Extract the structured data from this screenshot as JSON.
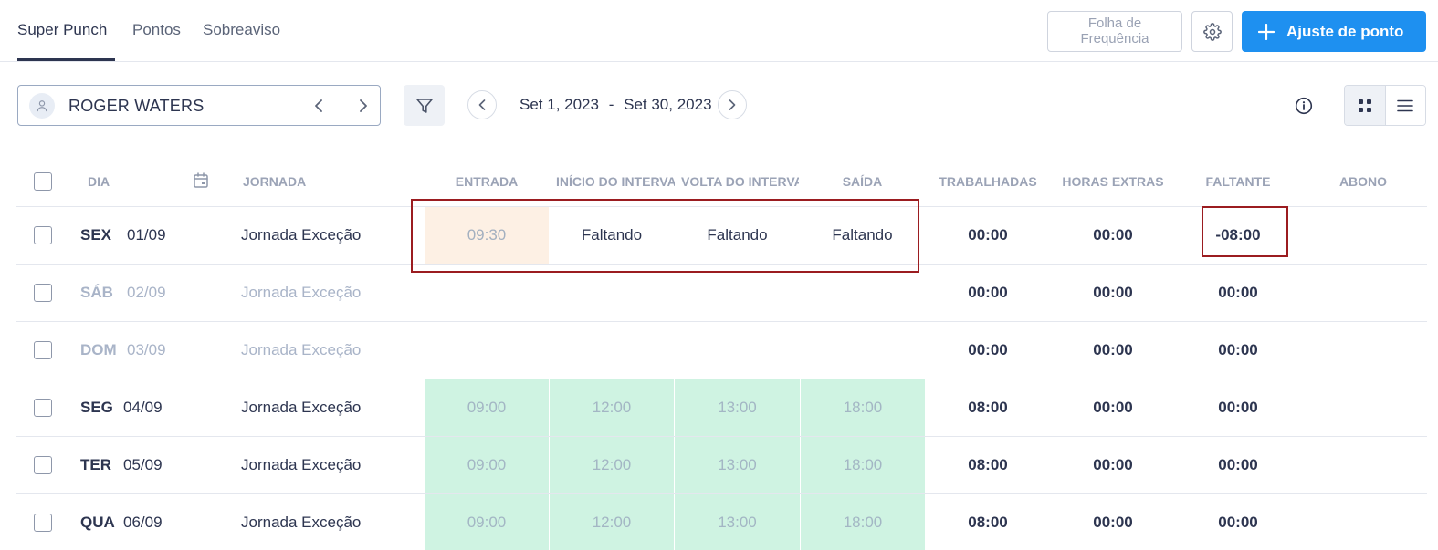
{
  "tabs": [
    {
      "label": "Super Punch",
      "active": true
    },
    {
      "label": "Pontos",
      "active": false
    },
    {
      "label": "Sobreaviso",
      "active": false
    }
  ],
  "header_actions": {
    "folha_line1": "Folha de",
    "folha_line2": "Frequência",
    "settings_icon": "gear-icon",
    "ajuste_label": "Ajuste de ponto",
    "ajuste_color": "#1e90f0"
  },
  "toolbar": {
    "employee_name": "ROGER WATERS",
    "date_start": "Set 1, 2023",
    "date_separator": "-",
    "date_end": "Set 30, 2023"
  },
  "table": {
    "columns": {
      "dia": "DIA",
      "jornada": "JORNADA",
      "entrada": "ENTRADA",
      "inicio": "INÍCIO DO INTERVALO",
      "volta": "VOLTA DO INTERVALO",
      "saida": "SAÍDA",
      "trabalhadas": "TRABALHADAS",
      "horas_extras": "HORAS EXTRAS",
      "faltante": "FALTANTE",
      "abono": "ABONO"
    },
    "rows": [
      {
        "weekday": "SEX",
        "date": "01/09",
        "jornada": "Jornada Exceção",
        "entrada": "09:30",
        "inicio": "Faltando",
        "volta": "Faltando",
        "saida": "Faltando",
        "trabalhadas": "00:00",
        "horas_extras": "00:00",
        "faltante": "-08:00",
        "abono": ""
      },
      {
        "weekday": "SÁB",
        "date": "02/09",
        "jornada": "Jornada Exceção",
        "entrada": "",
        "inicio": "",
        "volta": "",
        "saida": "",
        "trabalhadas": "00:00",
        "horas_extras": "00:00",
        "faltante": "00:00",
        "abono": ""
      },
      {
        "weekday": "DOM",
        "date": "03/09",
        "jornada": "Jornada Exceção",
        "entrada": "",
        "inicio": "",
        "volta": "",
        "saida": "",
        "trabalhadas": "00:00",
        "horas_extras": "00:00",
        "faltante": "00:00",
        "abono": ""
      },
      {
        "weekday": "SEG",
        "date": "04/09",
        "jornada": "Jornada Exceção",
        "entrada": "09:00",
        "inicio": "12:00",
        "volta": "13:00",
        "saida": "18:00",
        "trabalhadas": "08:00",
        "horas_extras": "00:00",
        "faltante": "00:00",
        "abono": ""
      },
      {
        "weekday": "TER",
        "date": "05/09",
        "jornada": "Jornada Exceção",
        "entrada": "09:00",
        "inicio": "12:00",
        "volta": "13:00",
        "saida": "18:00",
        "trabalhadas": "08:00",
        "horas_extras": "00:00",
        "faltante": "00:00",
        "abono": ""
      },
      {
        "weekday": "QUA",
        "date": "06/09",
        "jornada": "Jornada Exceção",
        "entrada": "09:00",
        "inicio": "12:00",
        "volta": "13:00",
        "saida": "18:00",
        "trabalhadas": "08:00",
        "horas_extras": "00:00",
        "faltante": "00:00",
        "abono": ""
      }
    ]
  },
  "colors": {
    "punch_ok_bg": "#cff3e2",
    "punch_partial_bg": "#fdf0e4",
    "highlight_border": "#9b1c20",
    "weekend_text": "#a9b4c8"
  }
}
